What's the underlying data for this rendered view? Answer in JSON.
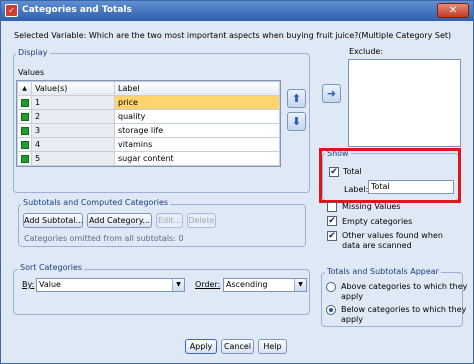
{
  "window": {
    "title": "Categories and Totals",
    "close_glyph": "✕",
    "app_icon": "spss-icon"
  },
  "selected_variable": "Selected Variable: Which are the two most important aspects when buying fruit juice?(Multiple Category Set)",
  "display": {
    "legend": "Display",
    "values_label": "Values",
    "columns": [
      "Value(s)",
      "Label"
    ],
    "rows": [
      {
        "value": "1",
        "label": "price",
        "selected": true
      },
      {
        "value": "2",
        "label": "quality",
        "selected": false
      },
      {
        "value": "3",
        "label": "storage life",
        "selected": false
      },
      {
        "value": "4",
        "label": "vitamins",
        "selected": false
      },
      {
        "value": "5",
        "label": "sugar content",
        "selected": false
      }
    ]
  },
  "exclude": {
    "label": "Exclude:"
  },
  "show": {
    "legend": "Show",
    "total_label": "Total",
    "total_checked": true,
    "label_label": "Label:",
    "label_value": "Total"
  },
  "options": {
    "missing_values": "Missing Values",
    "empty_categories": "Empty categories",
    "other_values_line1": "Other values found when",
    "other_values_line2": "data are scanned"
  },
  "subtotals": {
    "legend": "Subtotals and Computed Categories",
    "add_subtotal": "Add Subtotal...",
    "add_category": "Add Category...",
    "edit": "Edit...",
    "delete": "Delete",
    "note": "Categories omitted from all subtotals: 0"
  },
  "sort": {
    "legend": "Sort Categories",
    "by_label": "By:",
    "by_value": "Value",
    "order_label": "Order:",
    "order_value": "Ascending"
  },
  "totals_appear": {
    "legend": "Totals and Subtotals Appear",
    "above_line1": "Above categories to which they",
    "above_line2": "apply",
    "below_line1": "Below categories to which they",
    "below_line2": "apply",
    "selected": "below"
  },
  "footer": {
    "apply": "Apply",
    "cancel": "Cancel",
    "help": "Help"
  }
}
